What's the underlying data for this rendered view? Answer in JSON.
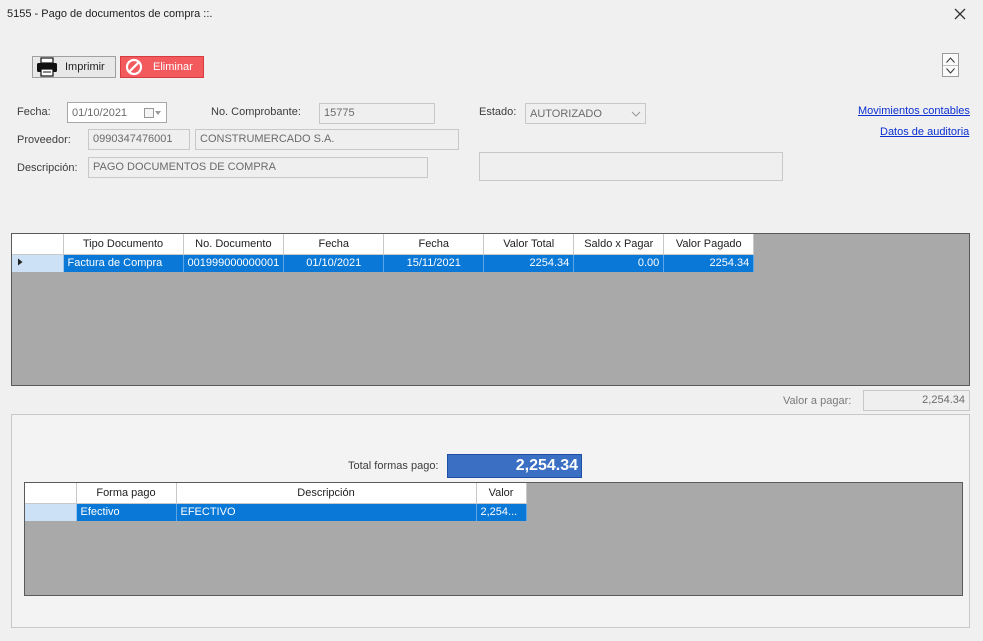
{
  "window": {
    "title": "5155 - Pago de documentos de compra ::."
  },
  "toolbar": {
    "print_label": "Imprimir",
    "delete_label": "Eliminar"
  },
  "form": {
    "fecha_label": "Fecha:",
    "fecha_value": "01/10/2021",
    "comprobante_label": "No. Comprobante:",
    "comprobante_value": "15775",
    "estado_label": "Estado:",
    "estado_value": "AUTORIZADO",
    "proveedor_label": "Proveedor:",
    "proveedor_id": "0990347476001",
    "proveedor_name": "CONSTRUMERCADO S.A.",
    "descripcion_label": "Descripción:",
    "descripcion_value": "PAGO DOCUMENTOS DE COMPRA",
    "extra_value": ""
  },
  "links": {
    "movimientos": "Movimientos contables",
    "auditoria": "Datos de auditoria"
  },
  "documents": {
    "headers": [
      "Tipo Documento",
      "No. Documento",
      "Fecha",
      "Fecha",
      "Valor Total",
      "Saldo x Pagar",
      "Valor Pagado"
    ],
    "rows": [
      [
        "Factura de Compra",
        "001999000000001",
        "01/10/2021",
        "15/11/2021",
        "2254.34",
        "0.00",
        "2254.34"
      ]
    ]
  },
  "valor_pagar": {
    "label": "Valor a pagar:",
    "value": "2,254.34"
  },
  "formas": {
    "total_label": "Total formas pago:",
    "total_value": "2,254.34",
    "headers": [
      "Forma pago",
      "Descripción",
      "Valor"
    ],
    "rows": [
      [
        "Efectivo",
        "EFECTIVO",
        "2,254..."
      ]
    ]
  },
  "colors": {
    "accent": "#0a78d7",
    "delete": "#f25a5e",
    "total_bg": "#3a6fc4",
    "grid_bg": "#a9a9a9"
  },
  "icons": [
    "close-icon",
    "printer-icon",
    "delete-icon",
    "calendar-icon",
    "chevron-down-icon",
    "row-pointer-icon",
    "arrow-up-icon",
    "arrow-down-icon"
  ]
}
